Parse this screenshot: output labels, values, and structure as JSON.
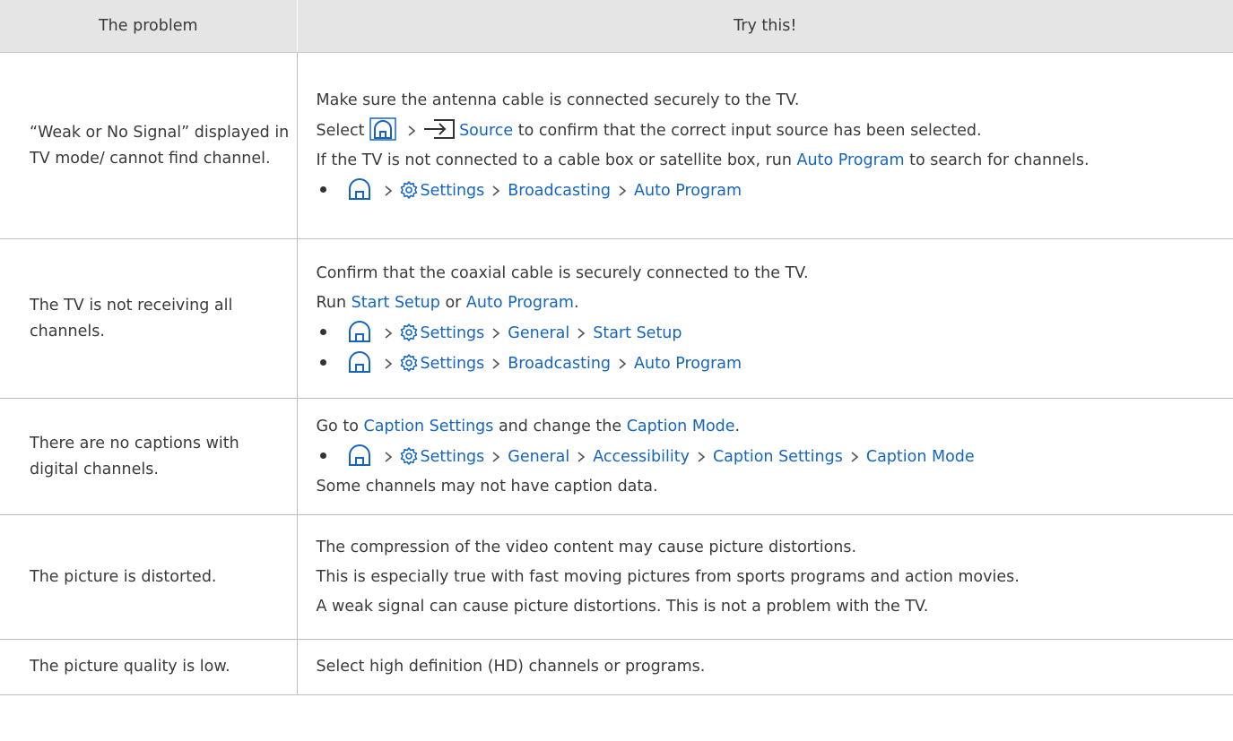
{
  "header": {
    "col_problem": "The problem",
    "col_try": "Try this!"
  },
  "rows": [
    {
      "problem": "“Weak or No Signal” displayed in TV mode/ cannot find channel.",
      "lines": {
        "l1": "Make sure the antenna cable is connected securely to the TV.",
        "l2_pre": "Select",
        "l2_link": "Source",
        "l2_post": " to confirm that the correct input source has been selected.",
        "l3_pre": "If the TV is not connected to a cable box or satellite box, run ",
        "l3_link": "Auto Program",
        "l3_post": " to search for channels.",
        "path": [
          "Settings",
          "Broadcasting",
          "Auto Program"
        ]
      }
    },
    {
      "problem": "The TV is not receiving all channels.",
      "lines": {
        "l1": "Confirm that the coaxial cable is securely connected to the TV.",
        "l2_pre": "Run ",
        "l2_link1": "Start Setup",
        "l2_mid": " or ",
        "l2_link2": "Auto Program",
        "l2_post": ".",
        "path1": [
          "Settings",
          "General",
          "Start Setup"
        ],
        "path2": [
          "Settings",
          "Broadcasting",
          "Auto Program"
        ]
      }
    },
    {
      "problem": "There are no captions with digital channels.",
      "lines": {
        "l1_pre": "Go to ",
        "l1_link1": "Caption Settings",
        "l1_mid": " and change the ",
        "l1_link2": "Caption Mode",
        "l1_post": ".",
        "path": [
          "Settings",
          "General",
          "Accessibility",
          "Caption Settings",
          "Caption Mode"
        ],
        "l3": "Some channels may not have caption data."
      }
    },
    {
      "problem": "The picture is distorted.",
      "lines": {
        "l1": "The compression of the video content may cause picture distortions.",
        "l2": "This is especially true with fast moving pictures from sports programs and action movies.",
        "l3": "A weak signal can cause picture distortions. This is not a problem with the TV."
      }
    },
    {
      "problem": "The picture quality is low.",
      "lines": {
        "l1": "Select high definition (HD) channels or programs."
      }
    }
  ],
  "icons": {
    "home": "home-icon",
    "settings": "gear-icon",
    "source": "source-icon",
    "separator": "chevron-right-icon",
    "bullet": "bullet-icon"
  },
  "colors": {
    "link": "#1565c0",
    "header_bg": "#e5e5e5",
    "text": "#3a3a3a"
  }
}
